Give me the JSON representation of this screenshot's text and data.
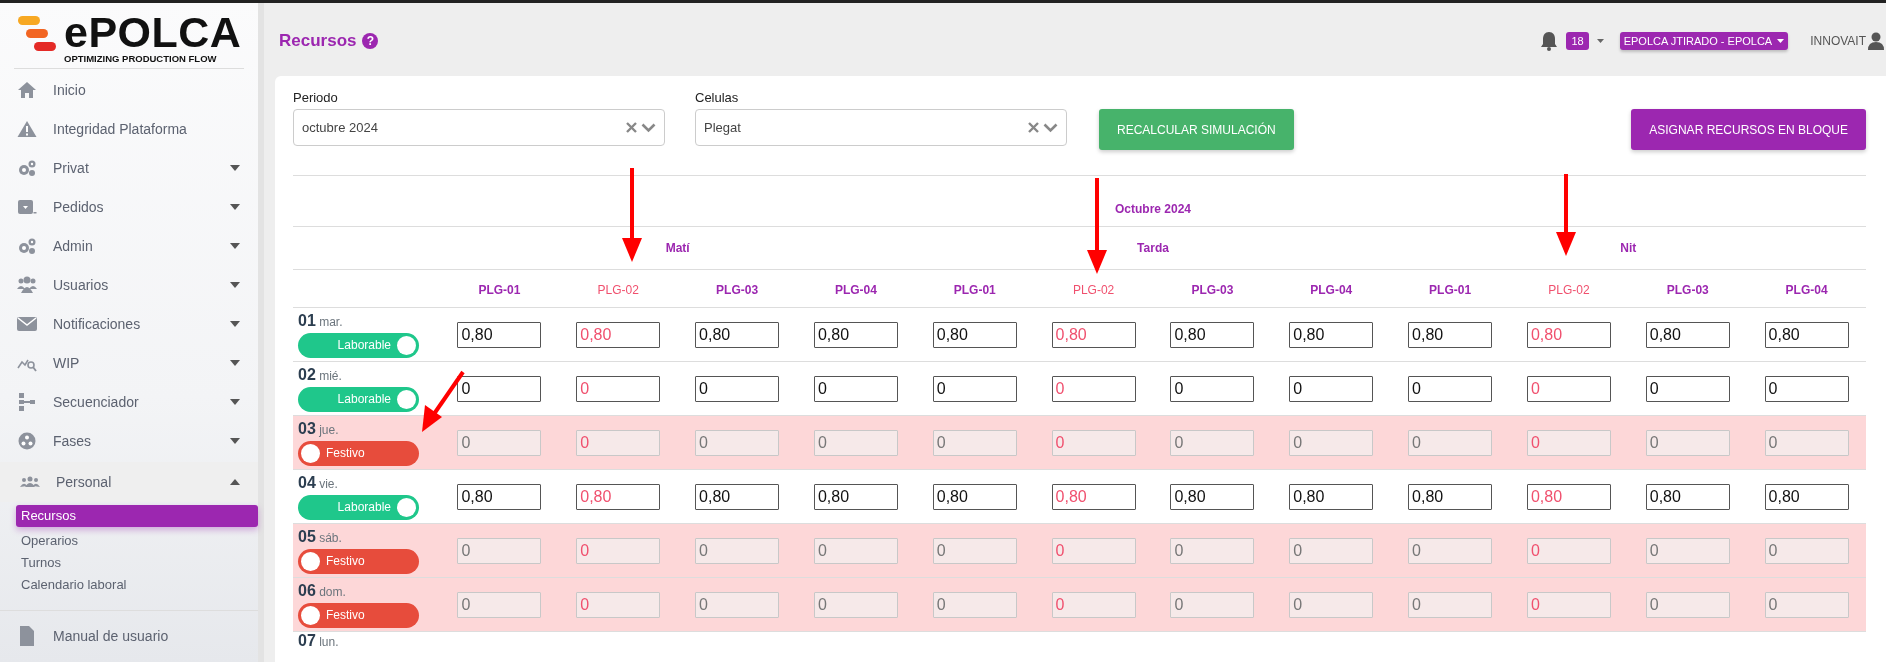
{
  "logo": {
    "name": "ePOLCA",
    "tagline": "OPTIMIZING PRODUCTION FLOW"
  },
  "sidebar": {
    "items": [
      {
        "label": "Inicio",
        "kind": "link"
      },
      {
        "label": "Integridad Plataforma",
        "kind": "link"
      },
      {
        "label": "Privat",
        "kind": "menu",
        "expanded": false
      },
      {
        "label": "Pedidos",
        "kind": "menu",
        "expanded": false
      },
      {
        "label": "Admin",
        "kind": "menu",
        "expanded": false
      },
      {
        "label": "Usuarios",
        "kind": "menu",
        "expanded": false
      },
      {
        "label": "Notificaciones",
        "kind": "menu",
        "expanded": false
      },
      {
        "label": "WIP",
        "kind": "menu",
        "expanded": false
      },
      {
        "label": "Secuenciador",
        "kind": "menu",
        "expanded": false
      },
      {
        "label": "Fases",
        "kind": "menu",
        "expanded": false
      },
      {
        "label": "Personal",
        "kind": "menu",
        "expanded": true,
        "children": [
          {
            "label": "Recursos",
            "selected": true
          },
          {
            "label": "Operarios",
            "selected": false
          },
          {
            "label": "Turnos",
            "selected": false
          },
          {
            "label": "Calendario laboral",
            "selected": false
          }
        ]
      }
    ],
    "footer_item": {
      "label": "Manual de usuario"
    }
  },
  "header": {
    "title": "Recursos",
    "help": "?",
    "notifications": "18",
    "user": "EPOLCA JTIRADO - EPOLCA",
    "company": "INNOVAIT"
  },
  "filters": [
    {
      "label": "Periodo",
      "value": "octubre 2024"
    },
    {
      "label": "Celulas",
      "value": "Plegat"
    }
  ],
  "buttons": [
    {
      "label": "RECALCULAR SIMULACIÓN",
      "kind": "success"
    },
    {
      "label": "ASIGNAR RECURSOS EN BLOQUE",
      "kind": "primary"
    }
  ],
  "table": {
    "month": "Octubre 2024",
    "shifts": [
      {
        "name": "Matí",
        "machines": [
          {
            "code": "PLG-01",
            "highlighted": false
          },
          {
            "code": "PLG-02",
            "highlighted": true
          },
          {
            "code": "PLG-03",
            "highlighted": false
          },
          {
            "code": "PLG-04",
            "highlighted": false
          }
        ]
      },
      {
        "name": "Tarda",
        "machines": [
          {
            "code": "PLG-01",
            "highlighted": false
          },
          {
            "code": "PLG-02",
            "highlighted": true
          },
          {
            "code": "PLG-03",
            "highlighted": false
          },
          {
            "code": "PLG-04",
            "highlighted": false
          }
        ]
      },
      {
        "name": "Nit",
        "machines": [
          {
            "code": "PLG-01",
            "highlighted": false
          },
          {
            "code": "PLG-02",
            "highlighted": true
          },
          {
            "code": "PLG-03",
            "highlighted": false
          },
          {
            "code": "PLG-04",
            "highlighted": false
          }
        ]
      }
    ],
    "rows": [
      {
        "day": "01",
        "weekday": "mar.",
        "laborable": true,
        "status": "Laborable",
        "values": [
          "0,80",
          "0,80",
          "0,80",
          "0,80",
          "0,80",
          "0,80",
          "0,80",
          "0,80",
          "0,80",
          "0,80",
          "0,80",
          "0,80"
        ]
      },
      {
        "day": "02",
        "weekday": "mié.",
        "laborable": true,
        "status": "Laborable",
        "values": [
          "0",
          "0",
          "0",
          "0",
          "0",
          "0",
          "0",
          "0",
          "0",
          "0",
          "0",
          "0"
        ]
      },
      {
        "day": "03",
        "weekday": "jue.",
        "laborable": false,
        "status": "Festivo",
        "values": [
          "0",
          "0",
          "0",
          "0",
          "0",
          "0",
          "0",
          "0",
          "0",
          "0",
          "0",
          "0"
        ]
      },
      {
        "day": "04",
        "weekday": "vie.",
        "laborable": true,
        "status": "Laborable",
        "values": [
          "0,80",
          "0,80",
          "0,80",
          "0,80",
          "0,80",
          "0,80",
          "0,80",
          "0,80",
          "0,80",
          "0,80",
          "0,80",
          "0,80"
        ]
      },
      {
        "day": "05",
        "weekday": "sáb.",
        "laborable": false,
        "status": "Festivo",
        "values": [
          "0",
          "0",
          "0",
          "0",
          "0",
          "0",
          "0",
          "0",
          "0",
          "0",
          "0",
          "0"
        ]
      },
      {
        "day": "06",
        "weekday": "dom.",
        "laborable": false,
        "status": "Festivo",
        "values": [
          "0",
          "0",
          "0",
          "0",
          "0",
          "0",
          "0",
          "0",
          "0",
          "0",
          "0",
          "0"
        ]
      },
      {
        "day": "07",
        "weekday": "lun."
      }
    ]
  }
}
